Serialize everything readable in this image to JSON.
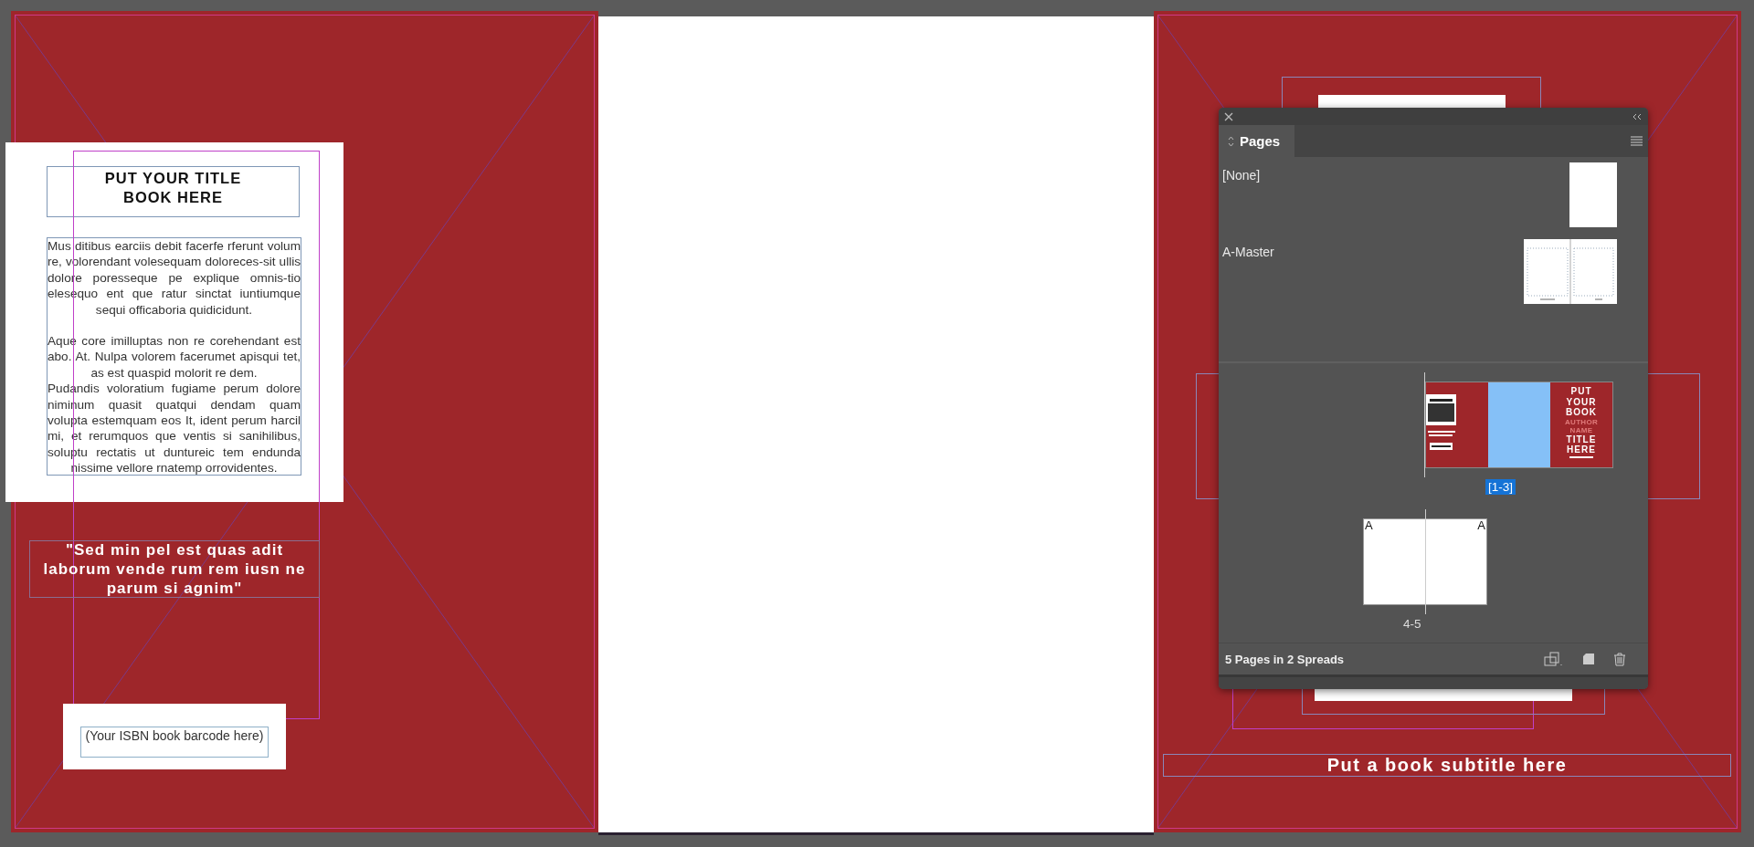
{
  "back_cover": {
    "title_lines": [
      "PUT YOUR TITLE",
      "BOOK HERE"
    ],
    "body": [
      "Mus ditibus earciis debit facerfe rferunt volum re, volorendant volesequam doloreces-sit ullis dolore poresseque pe explique omnis-tio elesequo ent que ratur sinctat iuntiumque sequi officaboria quidicidunt.",
      "Aque core imilluptas non re corehendant est abo. At. Nulpa volorem facerumet apisqui tet, as est quaspid molorit re dem.",
      "Pudandis voloratium fugiame perum dolore niminum quasit quatqui dendam quam volupta estemquam eos It, ident perum harcil mi, et rerumquos que ventis si sanihilibus, soluptu rectatis ut duntureic tem endunda nissime vellore rnatemp orrovidentes."
    ],
    "quote": "\"Sed min pel est quas adit laborum vende rum rem iusn ne parum si agnim\"",
    "barcode": "(Your ISBN book barcode here)"
  },
  "front_cover": {
    "subtitle": "Put a book subtitle here"
  },
  "pages_panel": {
    "tab": {
      "label": "Pages",
      "selected": true
    },
    "masters": [
      {
        "name": "[None]",
        "kind": "single"
      },
      {
        "name": "A-Master",
        "kind": "spread"
      }
    ],
    "spreads": [
      {
        "label": "[1-3]",
        "selected": true,
        "kind": "cover",
        "cover_lines": [
          {
            "text": "PUT",
            "kind": "title"
          },
          {
            "text": "YOUR",
            "kind": "title"
          },
          {
            "text": "BOOK",
            "kind": "title"
          },
          {
            "text": "AUTHOR",
            "kind": "author"
          },
          {
            "text": "NAME",
            "kind": "author"
          },
          {
            "text": "TITLE",
            "kind": "title"
          },
          {
            "text": "HERE",
            "kind": "title"
          }
        ]
      },
      {
        "label": "4-5",
        "selected": false,
        "kind": "pages",
        "master_marks": [
          "A",
          "A"
        ]
      }
    ],
    "status": "5 Pages in 2 Spreads"
  }
}
